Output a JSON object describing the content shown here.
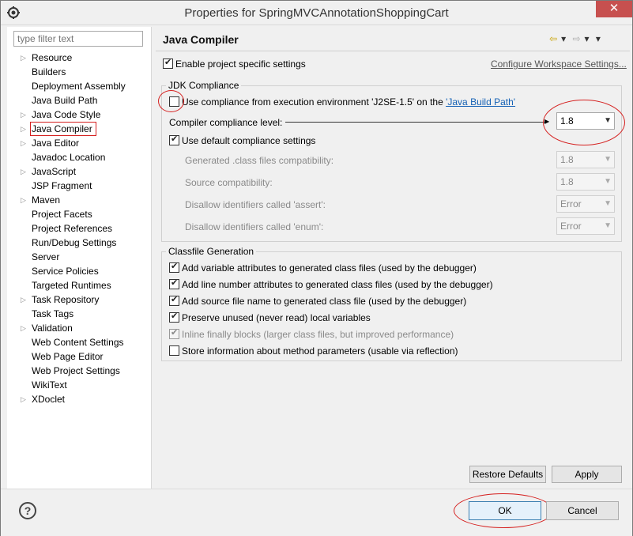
{
  "window": {
    "title": "Properties for SpringMVCAnnotationShoppingCart",
    "close_label": "✕"
  },
  "filter": {
    "placeholder": "type filter text"
  },
  "tree": {
    "items": [
      {
        "label": "Resource",
        "arrow": "▷"
      },
      {
        "label": "Builders",
        "arrow": ""
      },
      {
        "label": "Deployment Assembly",
        "arrow": ""
      },
      {
        "label": "Java Build Path",
        "arrow": ""
      },
      {
        "label": "Java Code Style",
        "arrow": "▷"
      },
      {
        "label": "Java Compiler",
        "arrow": "▷"
      },
      {
        "label": "Java Editor",
        "arrow": "▷"
      },
      {
        "label": "Javadoc Location",
        "arrow": ""
      },
      {
        "label": "JavaScript",
        "arrow": "▷"
      },
      {
        "label": "JSP Fragment",
        "arrow": ""
      },
      {
        "label": "Maven",
        "arrow": "▷"
      },
      {
        "label": "Project Facets",
        "arrow": ""
      },
      {
        "label": "Project References",
        "arrow": ""
      },
      {
        "label": "Run/Debug Settings",
        "arrow": ""
      },
      {
        "label": "Server",
        "arrow": ""
      },
      {
        "label": "Service Policies",
        "arrow": ""
      },
      {
        "label": "Targeted Runtimes",
        "arrow": ""
      },
      {
        "label": "Task Repository",
        "arrow": "▷"
      },
      {
        "label": "Task Tags",
        "arrow": ""
      },
      {
        "label": "Validation",
        "arrow": "▷"
      },
      {
        "label": "Web Content Settings",
        "arrow": ""
      },
      {
        "label": "Web Page Editor",
        "arrow": ""
      },
      {
        "label": "Web Project Settings",
        "arrow": ""
      },
      {
        "label": "WikiText",
        "arrow": ""
      },
      {
        "label": "XDoclet",
        "arrow": "▷"
      }
    ]
  },
  "page": {
    "title": "Java Compiler",
    "nav": {
      "back": "⇦",
      "back_menu": "▾",
      "forward": "⇨",
      "forward_menu": "▾",
      "view_menu": "▾"
    },
    "enable_project_specific": "Enable project specific settings",
    "configure_link": "Configure Workspace Settings...",
    "jdk_group_title": "JDK Compliance",
    "use_compliance_prefix": "Use compliance from execution environment 'J2SE-1.5' on the ",
    "use_compliance_link": "'Java Build Path'",
    "compliance_level_label": "Compiler compliance level:",
    "compliance_level_value": "1.8",
    "use_default_label": "Use default compliance settings",
    "generated_label": "Generated .class files compatibility:",
    "generated_value": "1.8",
    "source_label": "Source compatibility:",
    "source_value": "1.8",
    "assert_label": "Disallow identifiers called 'assert':",
    "assert_value": "Error",
    "enum_label": "Disallow identifiers called 'enum':",
    "enum_value": "Error",
    "classfile_group_title": "Classfile Generation",
    "classfile_options": [
      {
        "label": "Add variable attributes to generated class files (used by the debugger)",
        "checked": true,
        "disabled": false
      },
      {
        "label": "Add line number attributes to generated class files (used by the debugger)",
        "checked": true,
        "disabled": false
      },
      {
        "label": "Add source file name to generated class file (used by the debugger)",
        "checked": true,
        "disabled": false
      },
      {
        "label": "Preserve unused (never read) local variables",
        "checked": true,
        "disabled": false
      },
      {
        "label": "Inline finally blocks (larger class files, but improved performance)",
        "checked": true,
        "disabled": true
      },
      {
        "label": "Store information about method parameters (usable via reflection)",
        "checked": false,
        "disabled": false
      }
    ],
    "restore_defaults": "Restore Defaults",
    "apply": "Apply"
  },
  "footer": {
    "help": "?",
    "ok": "OK",
    "cancel": "Cancel"
  },
  "colors": {
    "annotation": "#d5201f",
    "link": "#1662b5"
  }
}
